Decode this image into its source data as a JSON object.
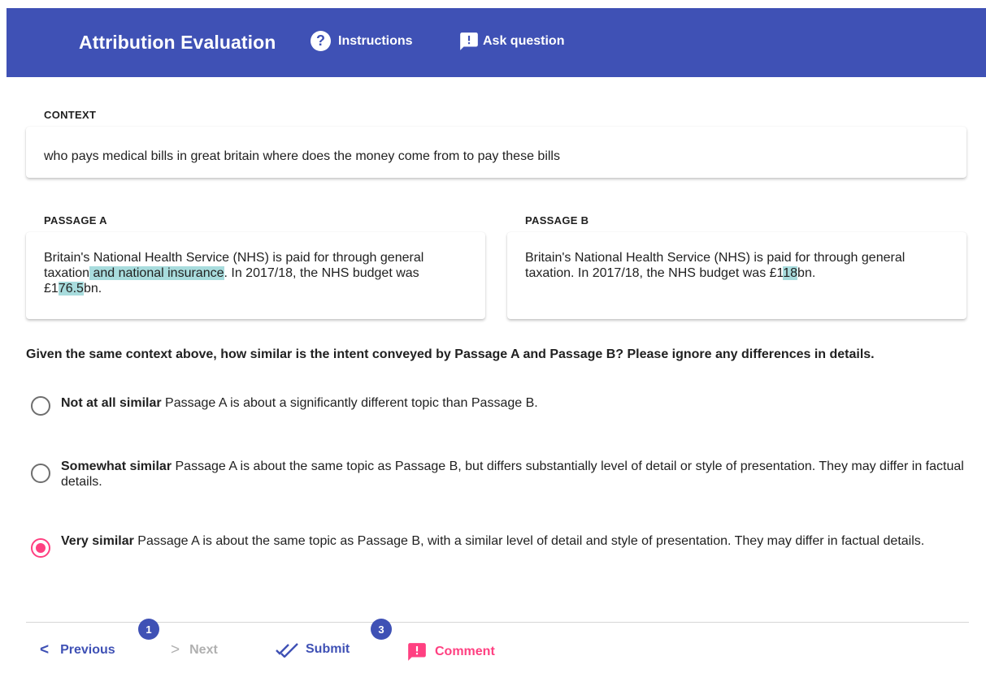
{
  "header": {
    "title": "Attribution Evaluation",
    "instructions_label": "Instructions",
    "ask_question_label": "Ask question",
    "background_color": "#3f51b5"
  },
  "context": {
    "label": "CONTEXT",
    "text": "who pays medical bills in great britain where does the money come from to pay these bills"
  },
  "passage_a": {
    "label": "PASSAGE A",
    "segments": [
      {
        "text": "Britain's National Health Service (NHS) is paid for through general taxation",
        "highlight": false
      },
      {
        "text": " and national insurance",
        "highlight": true
      },
      {
        "text": ". In 2017/18, the NHS budget was £1",
        "highlight": false
      },
      {
        "text": "76.5",
        "highlight": true
      },
      {
        "text": "bn.",
        "highlight": false
      }
    ]
  },
  "passage_b": {
    "label": "PASSAGE B",
    "segments": [
      {
        "text": "Britain's National Health Service (NHS) is paid for through general taxation. In 2017/18, the NHS budget was £1",
        "highlight": false
      },
      {
        "text": "18",
        "highlight": true
      },
      {
        "text": "bn.",
        "highlight": false
      }
    ]
  },
  "highlight_color": "#a8dcdd",
  "question": "Given the same context above, how similar is the intent conveyed by Passage A and Passage B? Please ignore any differences in details.",
  "options": [
    {
      "title": "Not at all similar",
      "description": " Passage A is about a significantly different topic than Passage B.",
      "selected": false
    },
    {
      "title": "Somewhat similar",
      "description": " Passage A is about the same topic as Passage B, but differs substantially level of detail or style of presentation. They may differ in factual details.",
      "selected": false
    },
    {
      "title": "Very similar",
      "description": " Passage A is about the same topic as Passage B, with a similar level of detail and style of presentation. They may differ in factual details.",
      "selected": true
    }
  ],
  "footer": {
    "previous_label": "Previous",
    "next_label": "Next",
    "submit_label": "Submit",
    "comment_label": "Comment",
    "previous_badge": "1",
    "submit_badge": "3",
    "accent_color": "#ff4081"
  }
}
